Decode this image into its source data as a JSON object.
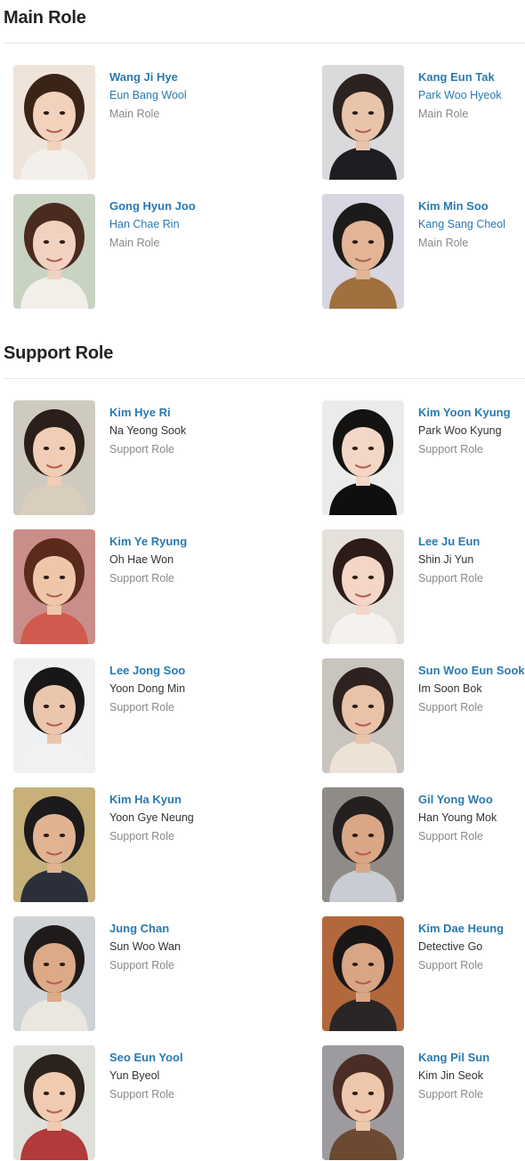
{
  "sections": [
    {
      "title": "Main Role",
      "cast": [
        {
          "actor": "Wang Ji Hye",
          "character": "Eun Bang Wool",
          "role": "Main Role",
          "bg": "#efe4da",
          "hair": "#3a2418",
          "shirt": "#f3f0ec",
          "skin": "#f2d2bd"
        },
        {
          "actor": "Kang Eun Tak",
          "character": "Park Woo Hyeok",
          "role": "Main Role",
          "bg": "#d9dadc",
          "hair": "#2c2220",
          "shirt": "#1e1e22",
          "skin": "#e8c4aa"
        },
        {
          "actor": "Gong Hyun Joo",
          "character": "Han Chae Rin",
          "role": "Main Role",
          "bg": "#c9d3c2",
          "hair": "#4a2b20",
          "shirt": "#f2efe9",
          "skin": "#f1d2c0"
        },
        {
          "actor": "Kim Min Soo",
          "character": "Kang Sang Cheol",
          "role": "Main Role",
          "bg": "#d8d6e0",
          "hair": "#1d1a1a",
          "shirt": "#a0703e",
          "skin": "#e2b596"
        }
      ]
    },
    {
      "title": "Support Role",
      "cast": [
        {
          "actor": "Kim Hye Ri",
          "character": "Na Yeong Sook",
          "role": "Support Role",
          "bg": "#cfcac0",
          "hair": "#2a1f1a",
          "shirt": "#d9cdbd",
          "skin": "#f0cdb4"
        },
        {
          "actor": "Kim Yoon Kyung",
          "character": "Park Woo Kyung",
          "role": "Support Role",
          "bg": "#ecebea",
          "hair": "#151212",
          "shirt": "#0f0f10",
          "skin": "#f2d6c6"
        },
        {
          "actor": "Kim Ye Ryung",
          "character": "Oh Hae Won",
          "role": "Support Role",
          "bg": "#c98e8a",
          "hair": "#5a2a1c",
          "shirt": "#d15a4e",
          "skin": "#efc7a8"
        },
        {
          "actor": "Lee Ju Eun",
          "character": "Shin Ji Yun",
          "role": "Support Role",
          "bg": "#e6e0db",
          "hair": "#2b1c18",
          "shirt": "#f4f1ee",
          "skin": "#f3d6c5"
        },
        {
          "actor": "Lee Jong Soo",
          "character": "Yoon Dong Min",
          "role": "Support Role",
          "bg": "#eef0f2",
          "hair": "#181617",
          "shirt": "#f2f2f3",
          "skin": "#eac6ac"
        },
        {
          "actor": "Sun Woo Eun Sook",
          "character": "Im Soon Bok",
          "role": "Support Role",
          "bg": "#c9c4be",
          "hair": "#2e2220",
          "shirt": "#ece3d6",
          "skin": "#e8c3a8"
        },
        {
          "actor": "Kim Ha Kyun",
          "character": "Yoon Gye Neung",
          "role": "Support Role",
          "bg": "#c7b07a",
          "hair": "#1c1a1a",
          "shirt": "#2a2f3a",
          "skin": "#e0b391"
        },
        {
          "actor": "Gil Yong Woo",
          "character": "Han Young Mok",
          "role": "Support Role",
          "bg": "#8f8c88",
          "hair": "#23201f",
          "shirt": "#c9ccd2",
          "skin": "#d9a786"
        },
        {
          "actor": "Jung Chan",
          "character": "Sun Woo Wan",
          "role": "Support Role",
          "bg": "#cfd3d6",
          "hair": "#1f1b1b",
          "shirt": "#eae6e0",
          "skin": "#dcaa86"
        },
        {
          "actor": "Kim Dae Heung",
          "character": "Detective Go",
          "role": "Support Role",
          "bg": "#b2683a",
          "hair": "#191616",
          "shirt": "#2a2626",
          "skin": "#d8a684"
        },
        {
          "actor": "Seo Eun Yool",
          "character": "Yun Byeol",
          "role": "Support Role",
          "bg": "#dfe0da",
          "hair": "#2b221d",
          "shirt": "#b13a3a",
          "skin": "#f0cbb0"
        },
        {
          "actor": "Kang Pil Sun",
          "character": "Kim Jin Seok",
          "role": "Support Role",
          "bg": "#9d9b9f",
          "hair": "#4a2e25",
          "shirt": "#6c4a32",
          "skin": "#edc8ad"
        }
      ]
    }
  ]
}
